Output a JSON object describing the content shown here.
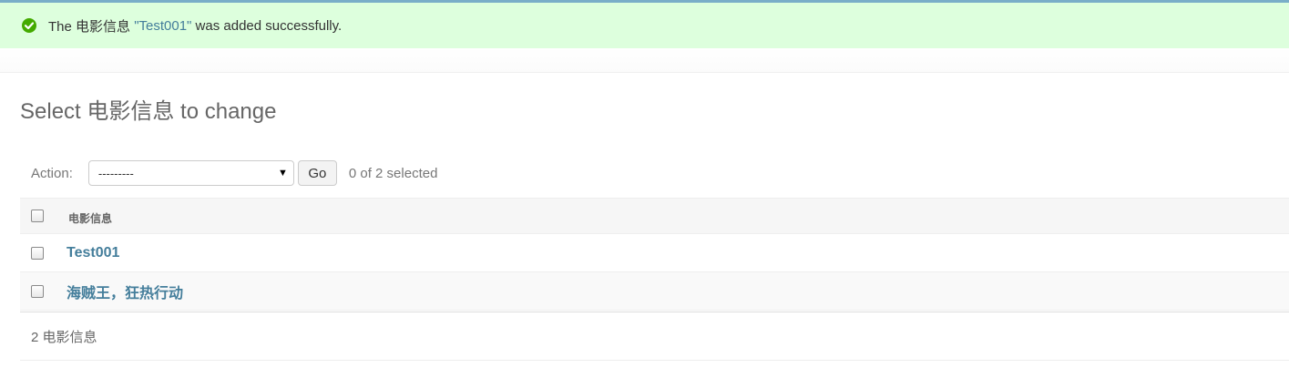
{
  "message": {
    "prefix": "The 电影信息 ",
    "object_link": "\"Test001\"",
    "suffix": " was added successfully.",
    "icon": "check-circle-icon",
    "color": "#44aa00"
  },
  "page": {
    "title": "Select 电影信息 to change"
  },
  "actions": {
    "label": "Action:",
    "selected_value": "---------",
    "go_label": "Go",
    "counter": "0 of 2 selected"
  },
  "table": {
    "header": "电影信息",
    "rows": [
      {
        "label": "Test001"
      },
      {
        "label": "海贼王，狂热行动"
      }
    ]
  },
  "paginator": {
    "text": "2 电影信息"
  },
  "colors": {
    "link": "#447e9b",
    "success_bg": "#ddffdd",
    "topline": "#79aec8"
  }
}
